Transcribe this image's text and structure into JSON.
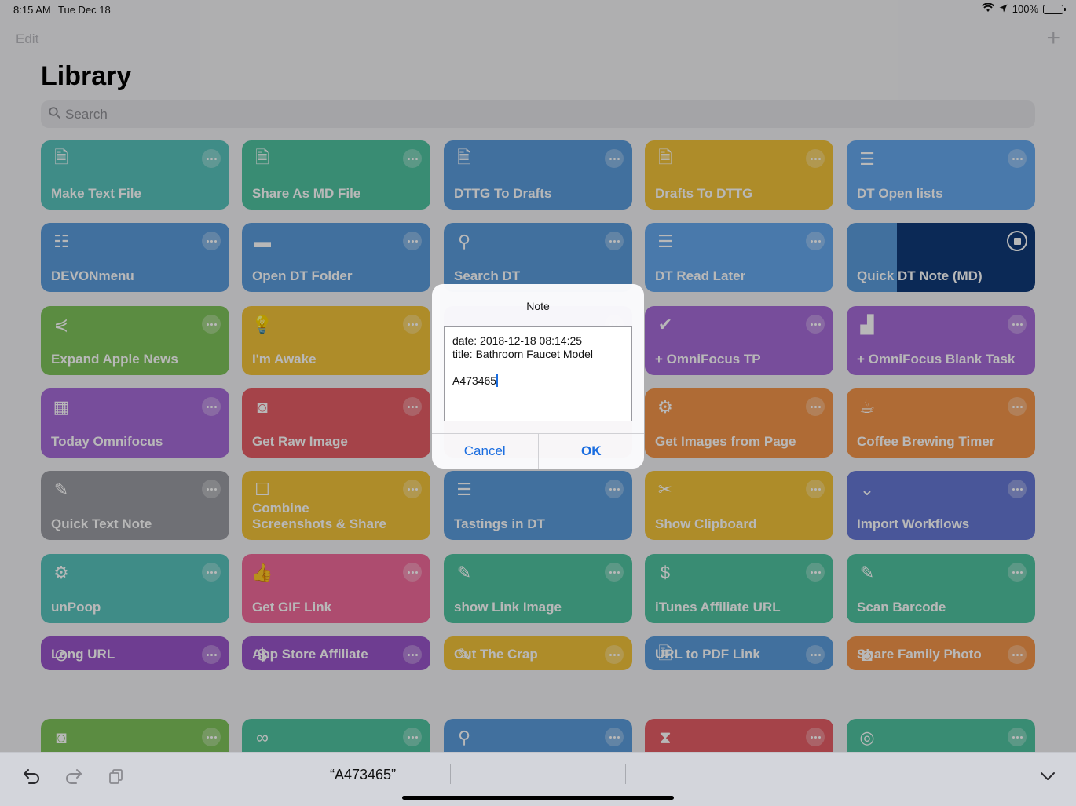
{
  "status": {
    "time": "8:15 AM",
    "date": "Tue Dec 18",
    "battery": "100%"
  },
  "nav": {
    "edit": "Edit",
    "add": "+"
  },
  "library": {
    "title": "Library",
    "search_placeholder": "Search"
  },
  "colors": {
    "teal": "#58c2bb",
    "green_teal": "#4fc3a0",
    "blue": "#5b9bdc",
    "yellow": "#f1c23a",
    "light_blue": "#66a8ee",
    "purple": "#a66bd7",
    "violet": "#9955c9",
    "red": "#e55e66",
    "orange": "#f3954a",
    "gray": "#9a9ba2",
    "indigo": "#6678d4",
    "pink": "#f06a9a",
    "lime": "#7ec35a",
    "dark_blue": "#103a78",
    "accent": "#1a6de0"
  },
  "tiles": [
    {
      "label": "Make Text File",
      "icon": "document-icon",
      "glyph": "🗎",
      "color": "#58c2bb"
    },
    {
      "label": "Share As MD File",
      "icon": "document-icon",
      "glyph": "🗎",
      "color": "#4fc3a0"
    },
    {
      "label": "DTTG To Drafts",
      "icon": "document-icon",
      "glyph": "🗎",
      "color": "#5b9bdc"
    },
    {
      "label": "Drafts To DTTG",
      "icon": "document-icon",
      "glyph": "🗎",
      "color": "#f1c23a"
    },
    {
      "label": "DT Open lists",
      "icon": "list-icon",
      "glyph": "☰",
      "color": "#66a8ee"
    },
    {
      "label": "DEVONmenu",
      "icon": "database-icon",
      "glyph": "☷",
      "color": "#5b9bdc"
    },
    {
      "label": "Open DT Folder",
      "icon": "folder-icon",
      "glyph": "▬",
      "color": "#5b9bdc"
    },
    {
      "label": "Search DT",
      "icon": "search-icon",
      "glyph": "⚲",
      "color": "#5b9bdc"
    },
    {
      "label": "DT Read Later",
      "icon": "list-icon",
      "glyph": "☰",
      "color": "#66a8ee"
    },
    {
      "label": "Quick DT Note (MD)",
      "icon": "stop-icon",
      "glyph": "",
      "color": "#103a78",
      "running": true
    },
    {
      "label": "Expand Apple News",
      "icon": "share-icon",
      "glyph": "⋞",
      "color": "#7ec35a"
    },
    {
      "label": "I'm Awake",
      "icon": "lightbulb-icon",
      "glyph": "💡",
      "color": "#f1c23a"
    },
    {
      "label": "",
      "icon": "",
      "glyph": "",
      "color": "#9955c9"
    },
    {
      "label": "+ OmniFocus TP",
      "icon": "checkmark-icon",
      "glyph": "✔",
      "color": "#a66bd7"
    },
    {
      "label": "+ OmniFocus Blank Task",
      "icon": "chart-icon",
      "glyph": "▟",
      "color": "#a66bd7"
    },
    {
      "label": "Today Omnifocus",
      "icon": "calendar-icon",
      "glyph": "▦",
      "color": "#a66bd7"
    },
    {
      "label": "Get Raw Image",
      "icon": "camera-icon",
      "glyph": "◙",
      "color": "#e55e66"
    },
    {
      "label": "",
      "icon": "",
      "glyph": "",
      "color": "#e55e66"
    },
    {
      "label": "Get Images from Page",
      "icon": "gear-icon",
      "glyph": "⚙",
      "color": "#f3954a"
    },
    {
      "label": "Coffee Brewing Timer",
      "icon": "coffee-icon",
      "glyph": "☕",
      "color": "#f3954a"
    },
    {
      "label": "Quick Text Note",
      "icon": "magic-wand-icon",
      "glyph": "✎",
      "color": "#9a9ba2"
    },
    {
      "label": "Combine\nScreenshots & Share",
      "icon": "square-icon",
      "glyph": "☐",
      "color": "#f1c23a"
    },
    {
      "label": "Tastings in DT",
      "icon": "list-icon",
      "glyph": "☰",
      "color": "#5b9bdc"
    },
    {
      "label": "Show Clipboard",
      "icon": "scissors-icon",
      "glyph": "✂",
      "color": "#f1c23a"
    },
    {
      "label": "Import Workflows",
      "icon": "chevron-circle-icon",
      "glyph": "⌄",
      "color": "#6678d4"
    },
    {
      "label": "unPoop",
      "icon": "gears-icon",
      "glyph": "⚙",
      "color": "#58c2bb"
    },
    {
      "label": "Get GIF Link",
      "icon": "thumbs-up-icon",
      "glyph": "👍",
      "color": "#f06a9a"
    },
    {
      "label": "show Link Image",
      "icon": "magic-wand-icon",
      "glyph": "✎",
      "color": "#4fc3a0"
    },
    {
      "label": "iTunes Affiliate URL",
      "icon": "dollar-icon",
      "glyph": "$",
      "color": "#4fc3a0"
    },
    {
      "label": "Scan Barcode",
      "icon": "magic-wand-icon",
      "glyph": "✎",
      "color": "#4fc3a0"
    },
    {
      "label": "Long URL",
      "icon": "compass-icon",
      "glyph": "⊘",
      "color": "#9955c9"
    },
    {
      "label": "App Store Affiliate",
      "icon": "dollar-icon",
      "glyph": "$",
      "color": "#9955c9"
    },
    {
      "label": "Cut The Crap",
      "icon": "magic-wand-icon",
      "glyph": "✎",
      "color": "#f1c23a"
    },
    {
      "label": "URL to PDF Link",
      "icon": "document-icon",
      "glyph": "🗎",
      "color": "#5b9bdc"
    },
    {
      "label": "Share Family Photo",
      "icon": "camera-icon",
      "glyph": "◙",
      "color": "#f3954a"
    },
    {
      "label": "",
      "icon": "camera-icon",
      "glyph": "◙",
      "color": "#7ec35a"
    },
    {
      "label": "",
      "icon": "glasses-icon",
      "glyph": "∞",
      "color": "#4fc3a0"
    },
    {
      "label": "",
      "icon": "search-icon",
      "glyph": "⚲",
      "color": "#5b9bdc"
    },
    {
      "label": "",
      "icon": "hourglass-icon",
      "glyph": "⧗",
      "color": "#e55e66"
    },
    {
      "label": "",
      "icon": "target-icon",
      "glyph": "◎",
      "color": "#4fc3a0"
    }
  ],
  "dialog": {
    "title": "Note",
    "text": "date: 2018-12-18 08:14:25\ntitle: Bathroom Faucet Model\n\nA473465",
    "cancel": "Cancel",
    "ok": "OK"
  },
  "keyboard_bar": {
    "suggestion": "“A473465”"
  }
}
